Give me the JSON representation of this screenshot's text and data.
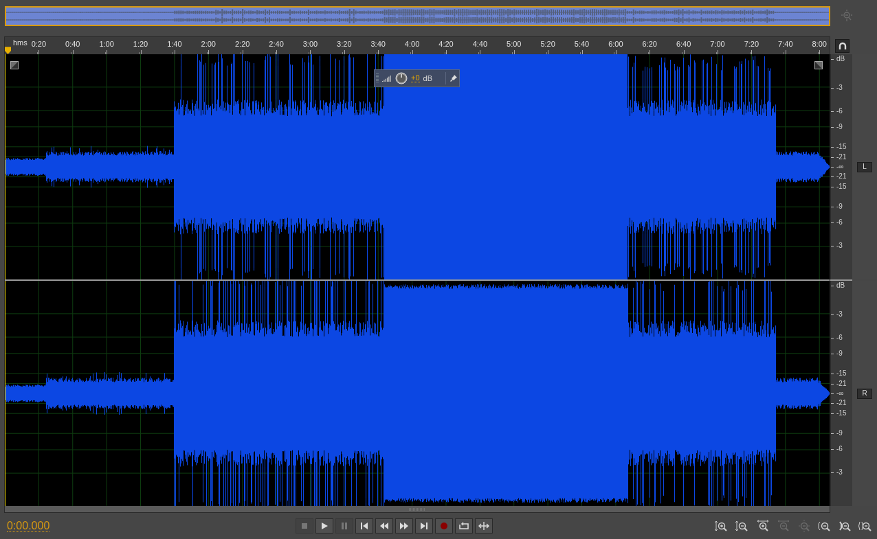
{
  "overview": {
    "zoom_button": {
      "disabled": true
    }
  },
  "ruler": {
    "unit": "hms",
    "ticks": [
      "0:20",
      "0:40",
      "1:00",
      "1:20",
      "1:40",
      "2:00",
      "2:20",
      "2:40",
      "3:00",
      "3:20",
      "3:40",
      "4:00",
      "4:20",
      "4:40",
      "5:00",
      "5:20",
      "5:40",
      "6:00",
      "6:20",
      "6:40",
      "7:00",
      "7:20",
      "7:40",
      "8:00"
    ]
  },
  "channels": [
    {
      "label": "L",
      "scale": [
        "dB",
        "-3",
        "-6",
        "-9",
        "-15",
        "-21",
        "-∞",
        "-21",
        "-15",
        "-9",
        "-6",
        "-3"
      ]
    },
    {
      "label": "R",
      "scale": [
        "dB",
        "-3",
        "-6",
        "-9",
        "-15",
        "-21",
        "-∞",
        "-21",
        "-15",
        "-9",
        "-6",
        "-3"
      ]
    }
  ],
  "hud": {
    "gain": "+0",
    "unit": "dB"
  },
  "time": "0:00.000",
  "transport": [
    {
      "kind": "stop",
      "disabled": true
    },
    {
      "kind": "play",
      "disabled": false
    },
    {
      "kind": "pause",
      "disabled": true
    },
    {
      "kind": "to-start",
      "disabled": false
    },
    {
      "kind": "rewind",
      "disabled": false
    },
    {
      "kind": "forward",
      "disabled": false
    },
    {
      "kind": "to-end",
      "disabled": false
    },
    {
      "kind": "record",
      "disabled": false
    },
    {
      "kind": "loop",
      "disabled": false
    },
    {
      "kind": "skip",
      "disabled": false
    }
  ],
  "zoom": [
    {
      "kind": "in-amplitude",
      "disabled": false
    },
    {
      "kind": "out-amplitude",
      "disabled": false
    },
    {
      "kind": "in-time",
      "disabled": false
    },
    {
      "kind": "out-time",
      "disabled": true
    },
    {
      "kind": "out-full",
      "disabled": true
    },
    {
      "kind": "in-left",
      "disabled": false
    },
    {
      "kind": "in-right",
      "disabled": false
    },
    {
      "kind": "in-selection",
      "disabled": false
    }
  ]
}
